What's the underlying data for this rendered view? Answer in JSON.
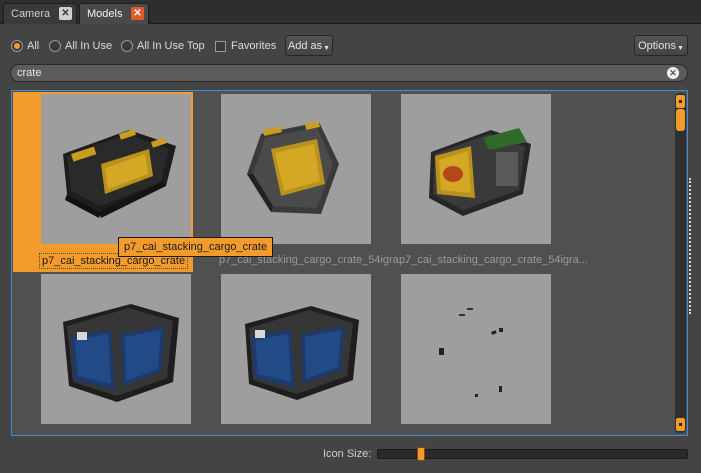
{
  "tabs": [
    {
      "label": "Camera",
      "active": false,
      "close_icon": "close-icon"
    },
    {
      "label": "Models",
      "active": true,
      "close_icon": "close-icon"
    }
  ],
  "filters": {
    "radios": [
      {
        "label": "All",
        "checked": true
      },
      {
        "label": "All In Use",
        "checked": false
      },
      {
        "label": "All In Use Top",
        "checked": false
      }
    ],
    "favorites": {
      "label": "Favorites",
      "checked": false
    },
    "add_as_label": "Add as",
    "options_label": "Options"
  },
  "search": {
    "value": "crate",
    "clear_icon": "clear-icon"
  },
  "grid": {
    "items": [
      {
        "caption": "p7_cai_stacking_cargo_crate",
        "selected": true
      },
      {
        "caption": "p7_cai_stacking_cargo_crate_54igra...",
        "selected": false
      },
      {
        "caption": "p7_cai_stacking_cargo_crate_54igra...",
        "selected": false
      },
      {
        "caption": "",
        "selected": false
      },
      {
        "caption": "",
        "selected": false
      },
      {
        "caption": "",
        "selected": false
      }
    ],
    "tooltip": "p7_cai_stacking_cargo_crate"
  },
  "icon_size": {
    "label": "Icon Size:",
    "value": 0.13
  },
  "colors": {
    "accent": "#f39c2c",
    "selection_border": "#3d8fd6",
    "thumb_bg": "#9e9e9e"
  }
}
